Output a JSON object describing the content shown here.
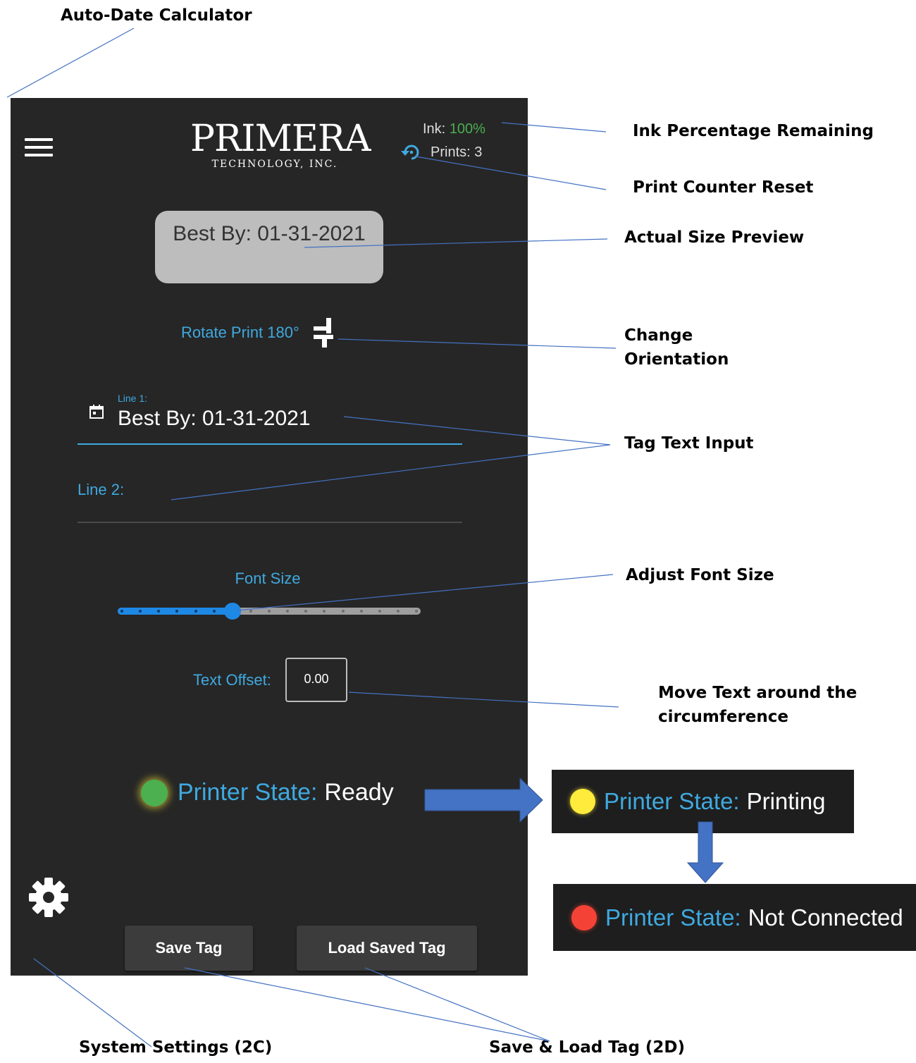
{
  "callouts": {
    "auto_date": "Auto-Date Calculator",
    "ink_percentage": "Ink Percentage Remaining",
    "print_counter_reset": "Print Counter Reset",
    "actual_size_preview": "Actual Size Preview",
    "change_orientation": "Change\nOrientation",
    "tag_text_input": "Tag Text Input",
    "adjust_font_size": "Adjust Font Size",
    "move_text": "Move Text around the\ncircumference",
    "system_settings": "System Settings (2C)",
    "save_load_tag": "Save & Load Tag (2D)"
  },
  "header": {
    "menu_icon": "hamburger-menu-icon",
    "logo_main": "PRIMERA",
    "logo_sub": "TECHNOLOGY, INC.",
    "ink_label": "Ink:",
    "ink_value": "100%",
    "prints_label": "Prints: 3",
    "reset_icon": "reset-counter-icon"
  },
  "preview": {
    "text": "Best By: 01-31-2021"
  },
  "rotate": {
    "label": "Rotate Print 180°",
    "icon": "rotate-orientation-icon"
  },
  "line1": {
    "label": "Line 1:",
    "value": "Best By: 01-31-2021",
    "icon": "calendar-icon"
  },
  "line2": {
    "label": "Line 2:",
    "value": ""
  },
  "font_size": {
    "label": "Font Size",
    "step": 6,
    "max_step": 16
  },
  "offset": {
    "label": "Text Offset:",
    "value": "0.00"
  },
  "printer_state": {
    "label": "Printer State:",
    "value": "Ready",
    "dot_color": "#4caf50"
  },
  "footer": {
    "settings_icon": "gear-icon",
    "save_button": "Save Tag",
    "load_button": "Load Saved Tag"
  },
  "state_examples": [
    {
      "label": "Printer State:",
      "value": "Printing",
      "dot_color": "#ffeb3b"
    },
    {
      "label": "Printer State:",
      "value": "Not Connected",
      "dot_color": "#f44336"
    }
  ],
  "colors": {
    "accent": "#3fa9e0",
    "panel_bg": "#262626",
    "arrow": "#4472c4"
  }
}
